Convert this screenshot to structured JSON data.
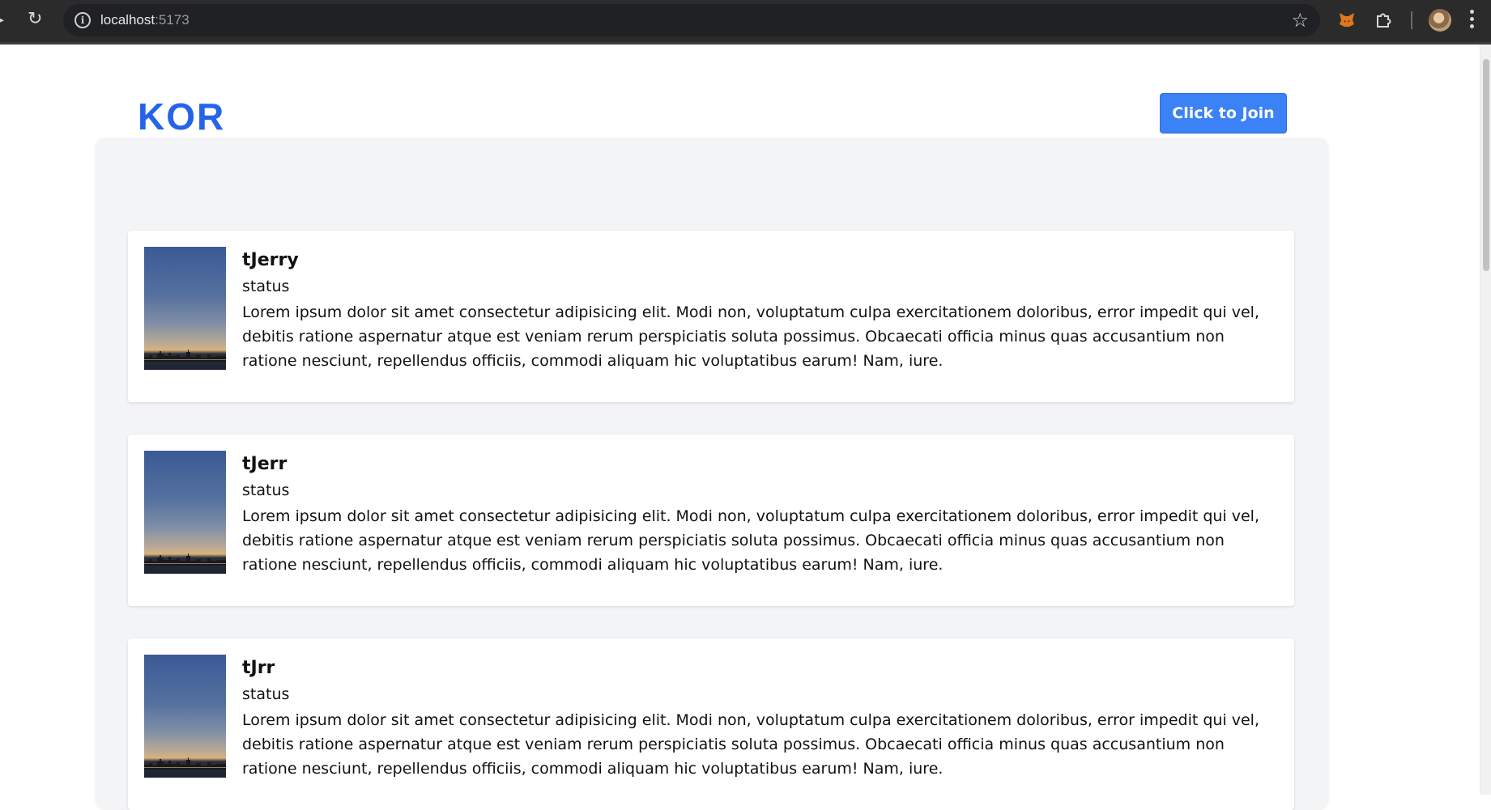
{
  "browser": {
    "url_host": "localhost",
    "url_port": ":5173"
  },
  "header": {
    "logo": "KOR",
    "join_button": "Click to Join"
  },
  "posts": [
    {
      "name": "tJerry",
      "status": "status",
      "bio": "Lorem ipsum dolor sit amet consectetur adipisicing elit. Modi non, voluptatum culpa exercitationem doloribus, error impedit qui vel, debitis ratione aspernatur atque est veniam rerum perspiciatis soluta possimus. Obcaecati officia minus quas accusantium non ratione nesciunt, repellendus officiis, commodi aliquam hic voluptatibus earum! Nam, iure."
    },
    {
      "name": "tJerr",
      "status": "status",
      "bio": "Lorem ipsum dolor sit amet consectetur adipisicing elit. Modi non, voluptatum culpa exercitationem doloribus, error impedit qui vel, debitis ratione aspernatur atque est veniam rerum perspiciatis soluta possimus. Obcaecati officia minus quas accusantium non ratione nesciunt, repellendus officiis, commodi aliquam hic voluptatibus earum! Nam, iure."
    },
    {
      "name": "tJrr",
      "status": "status",
      "bio": "Lorem ipsum dolor sit amet consectetur adipisicing elit. Modi non, voluptatum culpa exercitationem doloribus, error impedit qui vel, debitis ratione aspernatur atque est veniam rerum perspiciatis soluta possimus. Obcaecati officia minus quas accusantium non ratione nesciunt, repellendus officiis, commodi aliquam hic voluptatibus earum! Nam, iure."
    }
  ],
  "colors": {
    "brand": "#2563eb",
    "button": "#3b82f6",
    "panel_bg": "#f3f4f6"
  }
}
